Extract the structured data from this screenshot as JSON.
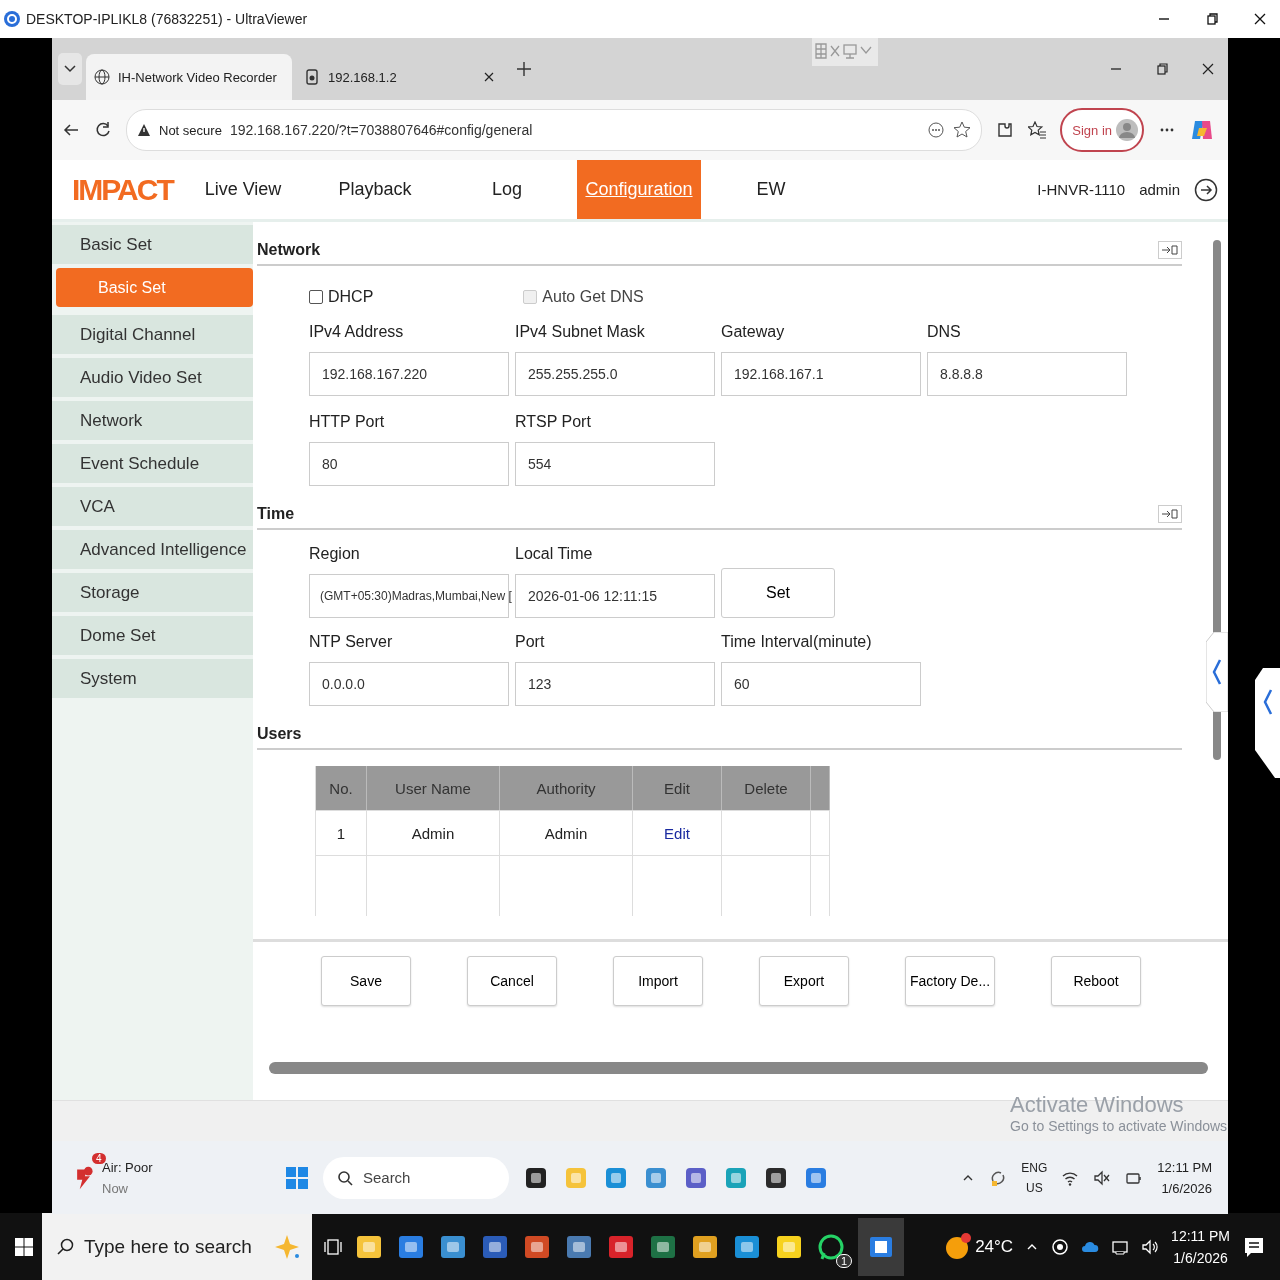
{
  "remote_window": {
    "title": "DESKTOP-IPLIKL8 (76832251) - UltraViewer"
  },
  "browser": {
    "tabs": [
      {
        "label": "IH-Network Video Recorder",
        "selected": true
      },
      {
        "label": "192.168.1.2",
        "selected": false
      }
    ],
    "security": "Not secure",
    "url": "192.168.167.220/?t=7038807646#config/general",
    "sign_in": "Sign in"
  },
  "app": {
    "logo": "IMPACT",
    "nav": [
      {
        "label": "Live View",
        "selected": false
      },
      {
        "label": "Playback",
        "selected": false
      },
      {
        "label": "Log",
        "selected": false
      },
      {
        "label": "Configuration",
        "selected": true
      },
      {
        "label": "EW",
        "selected": false
      }
    ],
    "device": "I-HNVR-1110",
    "user": "admin"
  },
  "sidebar": [
    {
      "label": "Basic Set",
      "selected": false,
      "children": [
        {
          "label": "Basic Set",
          "selected": true
        }
      ]
    },
    {
      "label": "Digital Channel",
      "selected": false
    },
    {
      "label": "Audio Video Set",
      "selected": false
    },
    {
      "label": "Network",
      "selected": false
    },
    {
      "label": "Event Schedule",
      "selected": false
    },
    {
      "label": "VCA",
      "selected": false
    },
    {
      "label": "Advanced Intelligence",
      "selected": false
    },
    {
      "label": "Storage",
      "selected": false
    },
    {
      "label": "Dome Set",
      "selected": false
    },
    {
      "label": "System",
      "selected": false
    }
  ],
  "network": {
    "title": "Network",
    "checkboxes": [
      {
        "label": "DHCP",
        "checked": false,
        "disabled": false
      },
      {
        "label": "Auto Get DNS",
        "checked": false,
        "disabled": true
      }
    ],
    "rows": [
      [
        {
          "kind": "input",
          "label": "IPv4 Address",
          "value": "192.168.167.220"
        },
        {
          "kind": "input",
          "label": "IPv4 Subnet Mask",
          "value": "255.255.255.0"
        },
        {
          "kind": "input",
          "label": "Gateway",
          "value": "192.168.167.1"
        },
        {
          "kind": "input",
          "label": "DNS",
          "value": "8.8.8.8"
        }
      ],
      [
        {
          "kind": "input",
          "label": "HTTP Port",
          "value": "80"
        },
        {
          "kind": "input",
          "label": "RTSP Port",
          "value": "554"
        }
      ]
    ]
  },
  "time": {
    "title": "Time",
    "rows": [
      [
        {
          "kind": "select",
          "label": "Region",
          "value": "(GMT+05:30)Madras,Mumbai,New ["
        },
        {
          "kind": "input",
          "label": "Local Time",
          "value": "2026-01-06 12:11:15"
        },
        {
          "kind": "button",
          "text": "Set"
        }
      ],
      [
        {
          "kind": "input",
          "label": "NTP Server",
          "value": "0.0.0.0"
        },
        {
          "kind": "input",
          "label": "Port",
          "value": "123"
        },
        {
          "kind": "input",
          "label": "Time Interval(minute)",
          "value": "60"
        }
      ]
    ]
  },
  "users": {
    "title": "Users",
    "columns": [
      "No.",
      "User Name",
      "Authority",
      "Edit",
      "Delete"
    ],
    "rows": [
      {
        "no": "1",
        "user_name": "Admin",
        "authority": "Admin",
        "edit": "Edit"
      }
    ]
  },
  "actions": [
    "Save",
    "Cancel",
    "Import",
    "Export",
    "Factory De...",
    "Reboot"
  ],
  "activation": {
    "title": "Activate Windows",
    "message": "Go to Settings to activate Windows"
  },
  "taskbar": {
    "weather": {
      "label": "Air: Poor",
      "time": "Now",
      "badge": "4"
    },
    "search": "Search",
    "language": "ENG",
    "region": "US",
    "time": "12:11 PM",
    "date": "1/6/2026"
  },
  "host_taskbar": {
    "search_placeholder": "Type here to search",
    "temperature": "24°C",
    "chat_badge": "1",
    "time": "12:11 PM",
    "date": "1/6/2026"
  }
}
